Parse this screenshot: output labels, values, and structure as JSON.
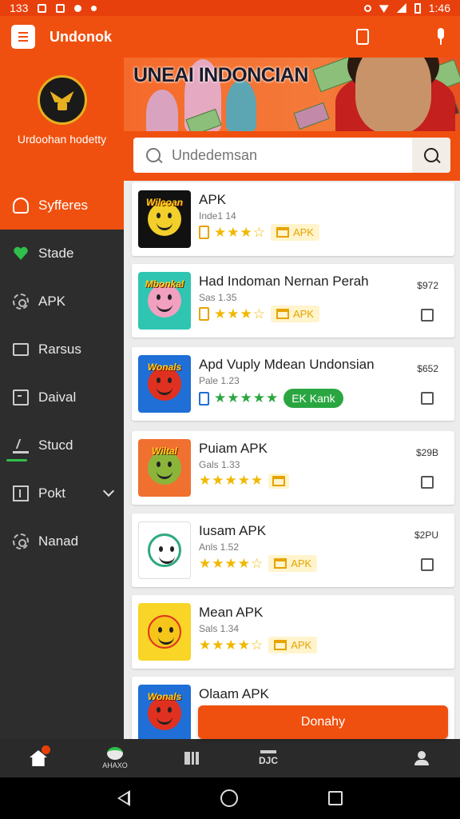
{
  "status_bar": {
    "left_text": "133",
    "time": "1:46"
  },
  "app_bar": {
    "title": "Undonok"
  },
  "sidebar": {
    "org_name": "Urdoohan hodetty",
    "items": [
      {
        "label": "Syfferes",
        "icon": "user-icon",
        "active": true
      },
      {
        "label": "Stade",
        "icon": "heart-icon",
        "active": false
      },
      {
        "label": "APK",
        "icon": "gear-icon",
        "active": false
      },
      {
        "label": "Rarsus",
        "icon": "screen-icon",
        "active": false
      },
      {
        "label": "Daival",
        "icon": "document-icon",
        "active": false
      },
      {
        "label": "Stucd",
        "icon": "stud-icon",
        "active": false
      },
      {
        "label": "Pokt",
        "icon": "pocket-icon",
        "active": false,
        "expandable": true
      },
      {
        "label": "Nanad",
        "icon": "gear-icon",
        "active": false
      }
    ]
  },
  "banner": {
    "title": "UNEAI INDONCIAN"
  },
  "search": {
    "placeholder": "Undedemsan"
  },
  "apps": [
    {
      "title": "APK",
      "sub": "Inde1 14",
      "stars": "★★★☆",
      "badge": "APK",
      "price": "",
      "checkbox": false,
      "thumb_word": "Wilcoan",
      "thumb_bg": "#111111",
      "face_color": "#f2cf2a"
    },
    {
      "title": "Had Indoman Nernan Perah",
      "sub": "Sas 1.35",
      "stars": "★★★☆",
      "badge": "APK",
      "price": "$972",
      "checkbox": true,
      "thumb_word": "Mbonkal",
      "thumb_bg": "#2fc5b0",
      "face_color": "#f2a0c0"
    },
    {
      "title": "Apd Vuply Mdean Undonsian",
      "sub": "Pale 1.23",
      "stars": "★★★★★",
      "badge": "EK Kank",
      "badge_style": "green",
      "price": "$652",
      "checkbox": true,
      "thumb_word": "Wonals",
      "thumb_bg": "#1f6fd6",
      "face_color": "#e03020"
    },
    {
      "title": "Puiam APK",
      "sub": "Gals 1.33",
      "stars": "★★★★★",
      "badge": "",
      "price": "$29B",
      "checkbox": true,
      "thumb_word": "Wiltal",
      "thumb_bg": "#f07030",
      "face_color": "#8bb53a"
    },
    {
      "title": "Iusam APK",
      "sub": "Anls 1.52",
      "stars": "★★★★☆",
      "badge": "APK",
      "price": "$2PU",
      "checkbox": true,
      "thumb_word": "",
      "thumb_bg": "#ffffff",
      "face_color": "#2fa880"
    },
    {
      "title": "Mean APK",
      "sub": "Sals 1.34",
      "stars": "★★★★☆",
      "badge": "APK",
      "price": "",
      "checkbox": false,
      "thumb_word": "",
      "thumb_bg": "#f8d526",
      "face_color": "#f5c51a"
    },
    {
      "title": "Olaam APK",
      "sub": "",
      "stars": "",
      "badge": "",
      "price": "",
      "checkbox": false,
      "thumb_word": "Wonals",
      "thumb_bg": "#1f6fd6",
      "face_color": "#e03020"
    }
  ],
  "cta": {
    "label": "Donahy"
  },
  "bottom_nav": [
    {
      "label": "",
      "icon": "home-icon"
    },
    {
      "label": "AHAXO",
      "icon": "leaf-icon"
    },
    {
      "label": "",
      "icon": "books-icon"
    },
    {
      "label": "DJC",
      "icon": "dtc-icon"
    },
    {
      "label": "",
      "icon": "person-icon"
    }
  ],
  "colors": {
    "primary": "#f0500f",
    "sidebar": "#2d2d2d",
    "star": "#f1b800",
    "green": "#2aa641"
  }
}
